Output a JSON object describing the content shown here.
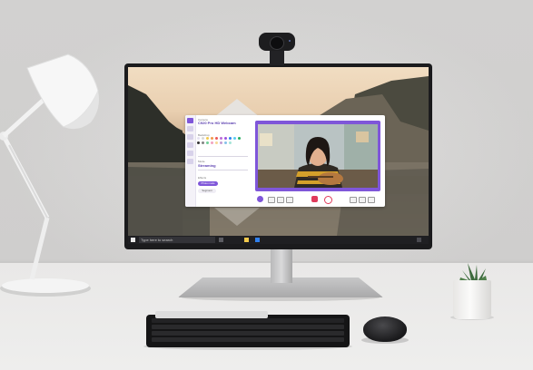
{
  "scene": {
    "colors": {
      "accent": "#7f56d9",
      "record": "#e03a5b",
      "taskbar": "#1f1f22"
    }
  },
  "app": {
    "header_small": "Camera",
    "device_name": "C920 Pro HD Webcam",
    "background_label": "Backdrop",
    "mode_label": "Mode",
    "mode_value": "Streaming",
    "section_label": "Effects",
    "pill_primary": "Photo mode",
    "pill_secondary": "Segment"
  },
  "taskbar": {
    "search_placeholder": "Type here to search"
  },
  "icons": [
    "windows-icon",
    "search-icon",
    "folder-icon",
    "store-icon",
    "settings-icon",
    "camera-icon",
    "record-icon",
    "photo-icon"
  ]
}
